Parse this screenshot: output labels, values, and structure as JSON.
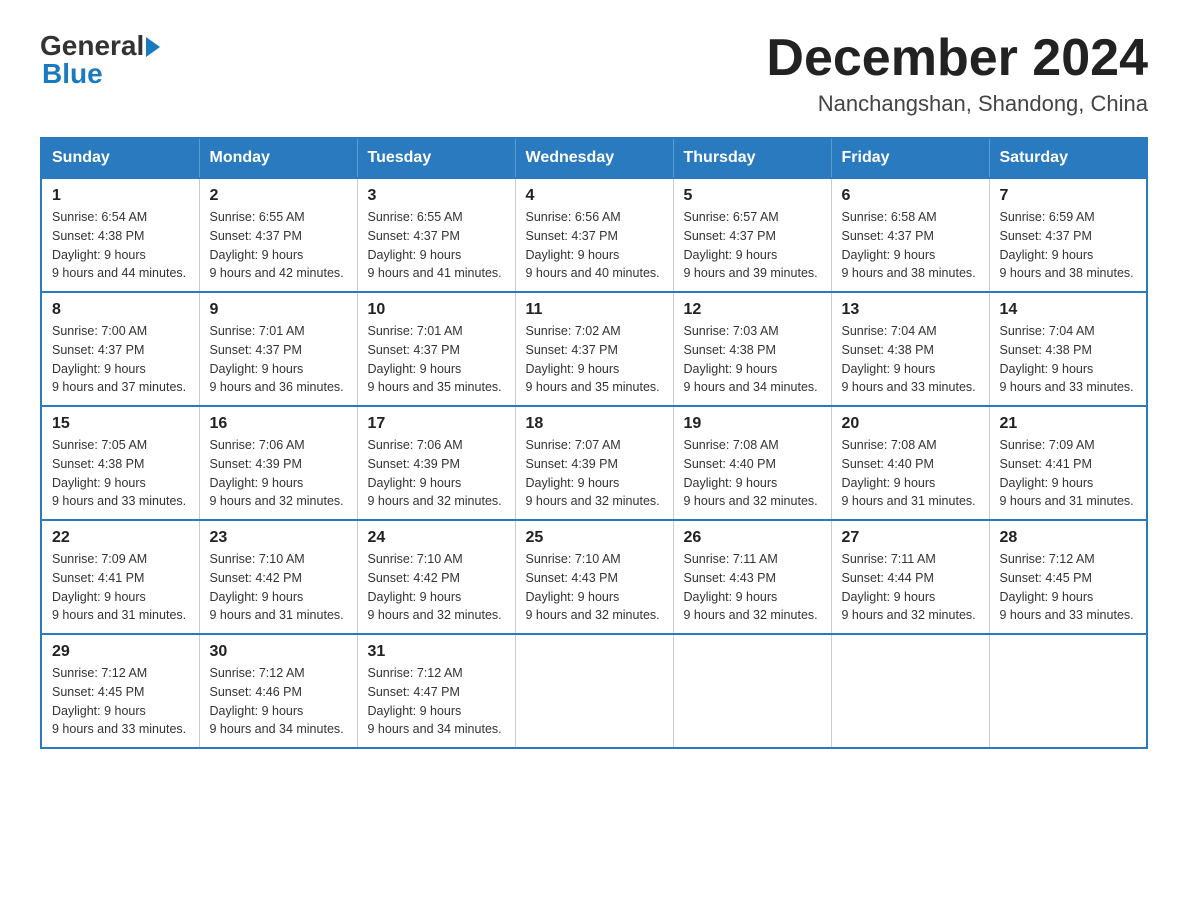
{
  "logo": {
    "general": "General",
    "blue": "Blue"
  },
  "title": "December 2024",
  "location": "Nanchangshan, Shandong, China",
  "headers": [
    "Sunday",
    "Monday",
    "Tuesday",
    "Wednesday",
    "Thursday",
    "Friday",
    "Saturday"
  ],
  "weeks": [
    [
      {
        "day": "1",
        "sunrise": "6:54 AM",
        "sunset": "4:38 PM",
        "daylight": "9 hours and 44 minutes."
      },
      {
        "day": "2",
        "sunrise": "6:55 AM",
        "sunset": "4:37 PM",
        "daylight": "9 hours and 42 minutes."
      },
      {
        "day": "3",
        "sunrise": "6:55 AM",
        "sunset": "4:37 PM",
        "daylight": "9 hours and 41 minutes."
      },
      {
        "day": "4",
        "sunrise": "6:56 AM",
        "sunset": "4:37 PM",
        "daylight": "9 hours and 40 minutes."
      },
      {
        "day": "5",
        "sunrise": "6:57 AM",
        "sunset": "4:37 PM",
        "daylight": "9 hours and 39 minutes."
      },
      {
        "day": "6",
        "sunrise": "6:58 AM",
        "sunset": "4:37 PM",
        "daylight": "9 hours and 38 minutes."
      },
      {
        "day": "7",
        "sunrise": "6:59 AM",
        "sunset": "4:37 PM",
        "daylight": "9 hours and 38 minutes."
      }
    ],
    [
      {
        "day": "8",
        "sunrise": "7:00 AM",
        "sunset": "4:37 PM",
        "daylight": "9 hours and 37 minutes."
      },
      {
        "day": "9",
        "sunrise": "7:01 AM",
        "sunset": "4:37 PM",
        "daylight": "9 hours and 36 minutes."
      },
      {
        "day": "10",
        "sunrise": "7:01 AM",
        "sunset": "4:37 PM",
        "daylight": "9 hours and 35 minutes."
      },
      {
        "day": "11",
        "sunrise": "7:02 AM",
        "sunset": "4:37 PM",
        "daylight": "9 hours and 35 minutes."
      },
      {
        "day": "12",
        "sunrise": "7:03 AM",
        "sunset": "4:38 PM",
        "daylight": "9 hours and 34 minutes."
      },
      {
        "day": "13",
        "sunrise": "7:04 AM",
        "sunset": "4:38 PM",
        "daylight": "9 hours and 33 minutes."
      },
      {
        "day": "14",
        "sunrise": "7:04 AM",
        "sunset": "4:38 PM",
        "daylight": "9 hours and 33 minutes."
      }
    ],
    [
      {
        "day": "15",
        "sunrise": "7:05 AM",
        "sunset": "4:38 PM",
        "daylight": "9 hours and 33 minutes."
      },
      {
        "day": "16",
        "sunrise": "7:06 AM",
        "sunset": "4:39 PM",
        "daylight": "9 hours and 32 minutes."
      },
      {
        "day": "17",
        "sunrise": "7:06 AM",
        "sunset": "4:39 PM",
        "daylight": "9 hours and 32 minutes."
      },
      {
        "day": "18",
        "sunrise": "7:07 AM",
        "sunset": "4:39 PM",
        "daylight": "9 hours and 32 minutes."
      },
      {
        "day": "19",
        "sunrise": "7:08 AM",
        "sunset": "4:40 PM",
        "daylight": "9 hours and 32 minutes."
      },
      {
        "day": "20",
        "sunrise": "7:08 AM",
        "sunset": "4:40 PM",
        "daylight": "9 hours and 31 minutes."
      },
      {
        "day": "21",
        "sunrise": "7:09 AM",
        "sunset": "4:41 PM",
        "daylight": "9 hours and 31 minutes."
      }
    ],
    [
      {
        "day": "22",
        "sunrise": "7:09 AM",
        "sunset": "4:41 PM",
        "daylight": "9 hours and 31 minutes."
      },
      {
        "day": "23",
        "sunrise": "7:10 AM",
        "sunset": "4:42 PM",
        "daylight": "9 hours and 31 minutes."
      },
      {
        "day": "24",
        "sunrise": "7:10 AM",
        "sunset": "4:42 PM",
        "daylight": "9 hours and 32 minutes."
      },
      {
        "day": "25",
        "sunrise": "7:10 AM",
        "sunset": "4:43 PM",
        "daylight": "9 hours and 32 minutes."
      },
      {
        "day": "26",
        "sunrise": "7:11 AM",
        "sunset": "4:43 PM",
        "daylight": "9 hours and 32 minutes."
      },
      {
        "day": "27",
        "sunrise": "7:11 AM",
        "sunset": "4:44 PM",
        "daylight": "9 hours and 32 minutes."
      },
      {
        "day": "28",
        "sunrise": "7:12 AM",
        "sunset": "4:45 PM",
        "daylight": "9 hours and 33 minutes."
      }
    ],
    [
      {
        "day": "29",
        "sunrise": "7:12 AM",
        "sunset": "4:45 PM",
        "daylight": "9 hours and 33 minutes."
      },
      {
        "day": "30",
        "sunrise": "7:12 AM",
        "sunset": "4:46 PM",
        "daylight": "9 hours and 34 minutes."
      },
      {
        "day": "31",
        "sunrise": "7:12 AM",
        "sunset": "4:47 PM",
        "daylight": "9 hours and 34 minutes."
      },
      null,
      null,
      null,
      null
    ]
  ]
}
